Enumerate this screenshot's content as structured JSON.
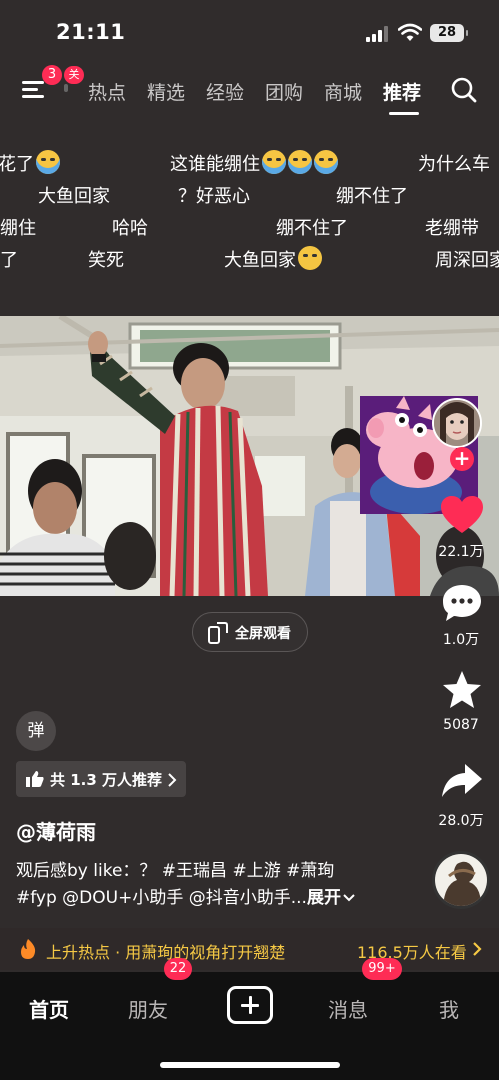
{
  "status_bar": {
    "time": "21:11",
    "battery": "28"
  },
  "top_nav": {
    "notification_count": "3",
    "follow_badge": "关",
    "tabs": [
      {
        "label": "热点"
      },
      {
        "label": "精选"
      },
      {
        "label": "经验"
      },
      {
        "label": "团购"
      },
      {
        "label": "商城"
      },
      {
        "label": "推荐"
      }
    ],
    "active_tab": "推荐"
  },
  "danmaku": [
    {
      "text": "花了"
    },
    {
      "text": "这谁能绷住"
    },
    {
      "text": "为什么车"
    },
    {
      "text": "大鱼回家"
    },
    {
      "text": "？好恶心"
    },
    {
      "text": "绷不住了"
    },
    {
      "text": "绷住"
    },
    {
      "text": "哈哈"
    },
    {
      "text": "绷不住了"
    },
    {
      "text": "老绷带"
    },
    {
      "text": "了"
    },
    {
      "text": "笑死"
    },
    {
      "text": "大鱼回家"
    },
    {
      "text": "周深回家"
    }
  ],
  "fullscreen": {
    "label": "全屏观看"
  },
  "rail": {
    "likes": "22.1万",
    "comments": "1.0万",
    "favorites": "5087",
    "shares": "28.0万"
  },
  "info": {
    "danmu_toggle": "弹",
    "recommend": "共 1.3 万人推荐",
    "author": "@薄荷雨",
    "desc_line1": "观后感by like：？ #王瑞昌 #上游 #萧珣",
    "desc_line2": "#fyp @DOU+小助手 @抖音小助手...",
    "expand": "展开"
  },
  "hot": {
    "text": "上升热点 · 用萧珣的视角打开翘楚",
    "watching": "116.5万人在看"
  },
  "tabbar": {
    "home": "首页",
    "friends": "朋友",
    "friends_badge": "22",
    "messages": "消息",
    "messages_badge": "99+",
    "me": "我"
  }
}
